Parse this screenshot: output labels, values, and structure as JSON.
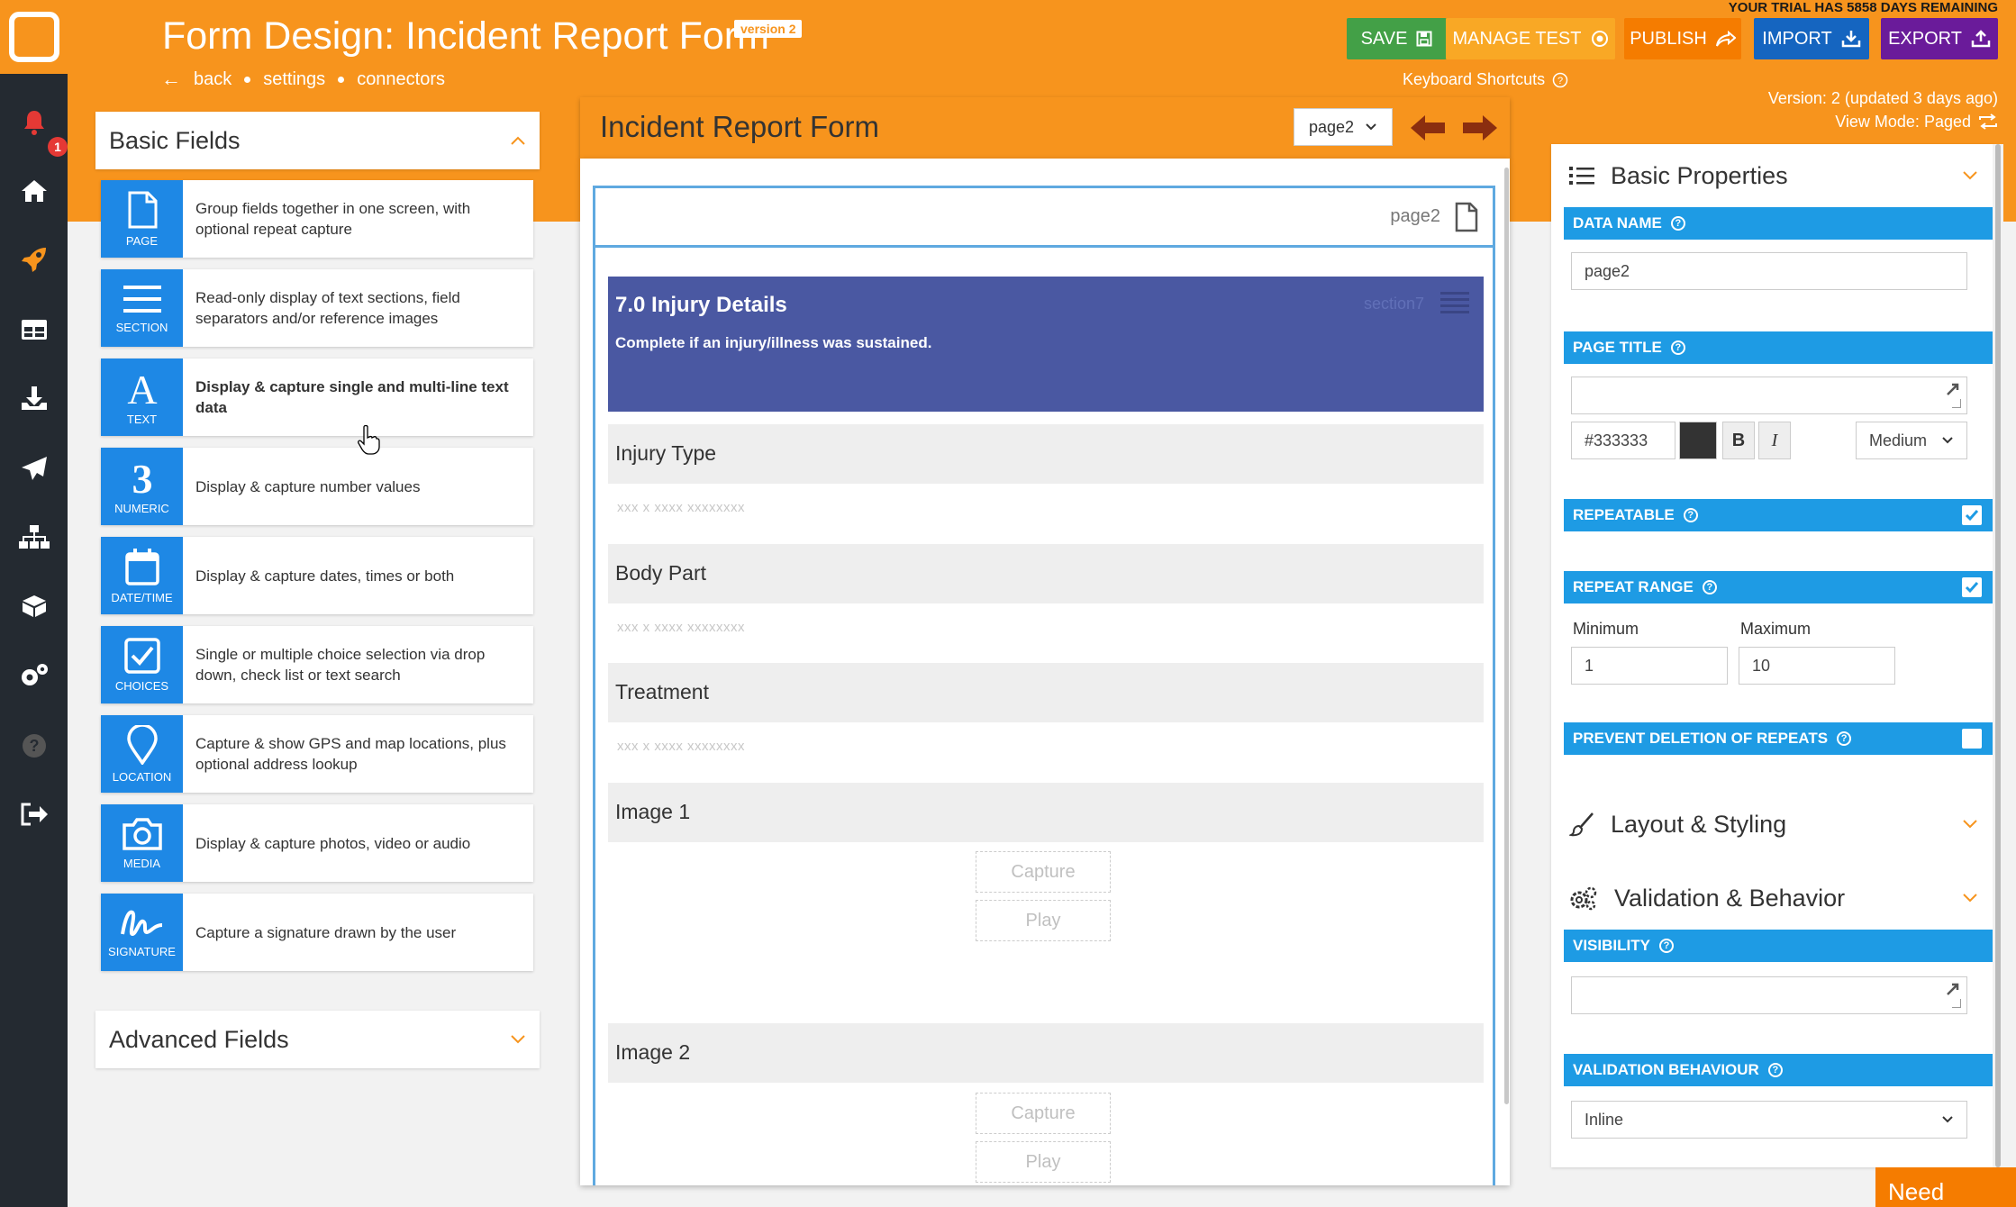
{
  "app": {
    "title": "Form Design: Incident Report Form",
    "version_badge": "version 2",
    "trial_notice": "YOUR TRIAL HAS 5858 DAYS REMAINING",
    "breadcrumb": {
      "back": "back",
      "settings": "settings",
      "connectors": "connectors"
    },
    "keyboard_shortcuts": "Keyboard Shortcuts",
    "version_info": "Version: 2 (updated 3 days ago)",
    "view_mode": "View Mode: Paged",
    "need_help": "Need Help?",
    "notification_count": "1"
  },
  "toolbar": {
    "save": "SAVE",
    "manage_test": "MANAGE TEST",
    "publish": "PUBLISH",
    "import": "IMPORT",
    "export": "EXPORT"
  },
  "colors": {
    "header": "#f7941d",
    "save": "#43a047",
    "manage_test": "#f9a825",
    "publish": "#f57c00",
    "import": "#1565c0",
    "export": "#6a1b9a",
    "field_icon": "#1e88e5",
    "section": "#4a58a2",
    "property_bar": "#1e9be4"
  },
  "left_panel": {
    "basic_title": "Basic Fields",
    "advanced_title": "Advanced Fields",
    "fields": [
      {
        "icon": "page-icon",
        "label": "PAGE",
        "desc": "Group fields together in one screen, with optional repeat capture"
      },
      {
        "icon": "section-icon",
        "label": "SECTION",
        "desc": "Read-only display of text sections, field separators and/or reference images"
      },
      {
        "icon": "text-icon",
        "label": "TEXT",
        "desc": "Display & capture single and multi-line text data"
      },
      {
        "icon": "numeric-icon",
        "label": "NUMERIC",
        "desc": "Display & capture number values"
      },
      {
        "icon": "calendar-icon",
        "label": "DATE/TIME",
        "desc": "Display & capture dates, times or both"
      },
      {
        "icon": "checkbox-icon",
        "label": "CHOICES",
        "desc": "Single or multiple choice selection via drop down, check list or text search"
      },
      {
        "icon": "location-pin-icon",
        "label": "LOCATION",
        "desc": "Capture & show GPS and map locations, plus optional address lookup"
      },
      {
        "icon": "camera-icon",
        "label": "MEDIA",
        "desc": "Display & capture photos, video or audio"
      },
      {
        "icon": "signature-icon",
        "label": "SIGNATURE",
        "desc": "Capture a signature drawn by the user"
      }
    ]
  },
  "form": {
    "title": "Incident Report Form",
    "page_select": "page2",
    "page_label": "page2",
    "section": {
      "title": "7.0 Injury Details",
      "subtitle": "Complete if an injury/illness was sustained.",
      "id": "section7"
    },
    "fields": [
      {
        "label": "Injury Type",
        "placeholder": "xxx x xxxx xxxxxxxx"
      },
      {
        "label": "Body Part",
        "placeholder": "xxx x xxxx xxxxxxxx"
      },
      {
        "label": "Treatment",
        "placeholder": "xxx x xxxx xxxxxxxx"
      }
    ],
    "images": [
      {
        "label": "Image 1",
        "capture": "Capture",
        "play": "Play"
      },
      {
        "label": "Image 2",
        "capture": "Capture",
        "play": "Play"
      }
    ]
  },
  "properties": {
    "basic_title": "Basic Properties",
    "data_name_label": "DATA NAME",
    "data_name_value": "page2",
    "page_title_label": "PAGE TITLE",
    "page_title_value": "",
    "color_value": "#333333",
    "bold": "B",
    "italic": "I",
    "size_value": "Medium",
    "repeatable_label": "REPEATABLE",
    "repeatable_checked": true,
    "repeat_range_label": "REPEAT RANGE",
    "repeat_range_checked": true,
    "minimum_label": "Minimum",
    "minimum_value": "1",
    "maximum_label": "Maximum",
    "maximum_value": "10",
    "prevent_deletion_label": "PREVENT DELETION OF REPEATS",
    "prevent_deletion_checked": false,
    "layout_title": "Layout & Styling",
    "validation_title": "Validation & Behavior",
    "visibility_label": "VISIBILITY",
    "visibility_value": "",
    "validation_behaviour_label": "VALIDATION BEHAVIOUR",
    "validation_behaviour_value": "Inline"
  }
}
